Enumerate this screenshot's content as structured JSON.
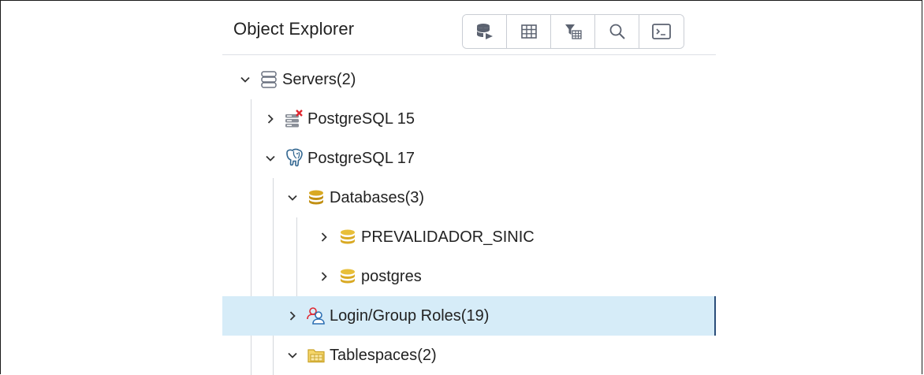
{
  "panel": {
    "title": "Object Explorer",
    "toolbar": [
      {
        "icon": "query-tool-icon",
        "label": "Query Tool"
      },
      {
        "icon": "view-data-icon",
        "label": "View Data"
      },
      {
        "icon": "filtered-rows-icon",
        "label": "View Filtered Rows"
      },
      {
        "icon": "search-objects-icon",
        "label": "Search Objects"
      },
      {
        "icon": "psql-tool-icon",
        "label": "PSQL Tool"
      }
    ]
  },
  "tree": {
    "items": [
      {
        "label": "Servers",
        "count": "(2)",
        "state": "expanded",
        "icon": "servers-icon"
      },
      {
        "label": "PostgreSQL 15",
        "count": "",
        "state": "collapsed",
        "icon": "server-disconnected-icon"
      },
      {
        "label": "PostgreSQL 17",
        "count": "",
        "state": "expanded",
        "icon": "postgresql-elephant-icon"
      },
      {
        "label": "Databases",
        "count": "(3)",
        "state": "expanded",
        "icon": "databases-icon"
      },
      {
        "label": "PREVALIDADOR_SINIC",
        "count": "",
        "state": "collapsed",
        "icon": "database-icon"
      },
      {
        "label": "postgres",
        "count": "",
        "state": "collapsed",
        "icon": "database-icon"
      },
      {
        "label": "Login/Group Roles",
        "count": "(19)",
        "state": "collapsed",
        "icon": "login-group-roles-icon",
        "selected": true
      },
      {
        "label": "Tablespaces",
        "count": "(2)",
        "state": "expanded",
        "icon": "tablespaces-icon"
      }
    ]
  },
  "colors": {
    "selected_bg": "#d6ecf8",
    "selected_border": "#2a4d7a",
    "database_gold": "#d9a923",
    "error_red": "#e0262f",
    "role_blue": "#2c6fb3"
  }
}
